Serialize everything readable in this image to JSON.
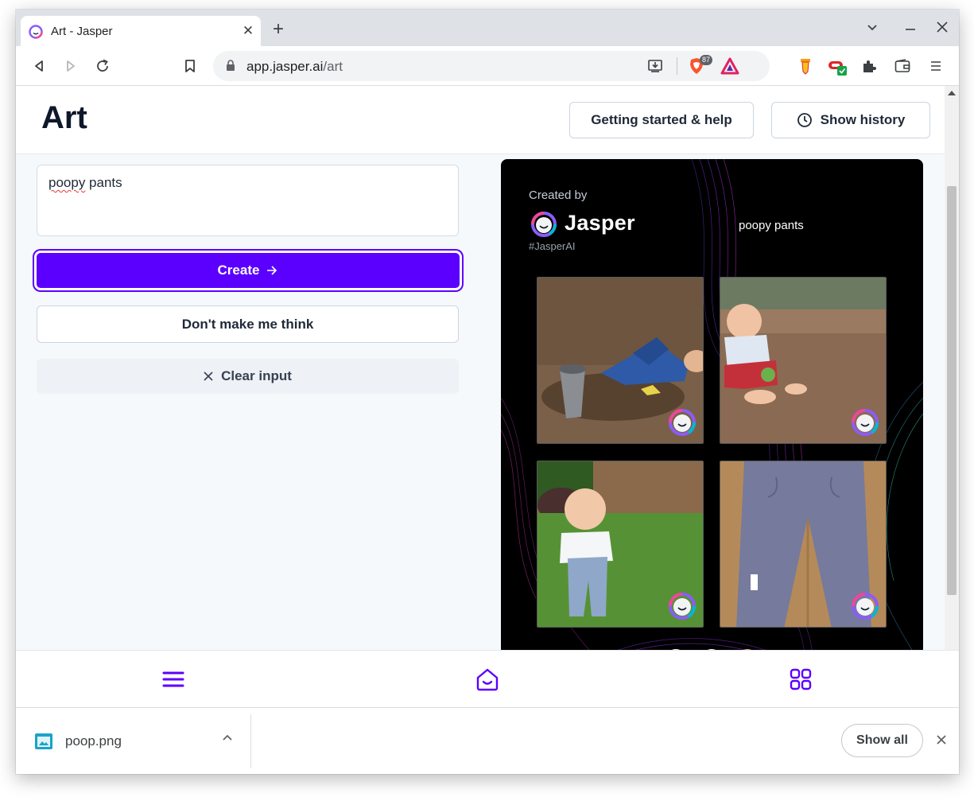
{
  "browser": {
    "tab_title": "Art - Jasper",
    "url_host": "app.jasper.ai",
    "url_path": "/art",
    "brave_badge": "87"
  },
  "header": {
    "title": "Art",
    "help_button": "Getting started & help",
    "history_button": "Show history"
  },
  "form": {
    "prompt_first_word": "poopy",
    "prompt_rest": " pants",
    "create_button": "Create",
    "dont_make_me_think_button": "Don't make me think",
    "clear_button": "Clear input"
  },
  "result_card": {
    "created_by": "Created by",
    "brand": "Jasper",
    "hashtag": "#JasperAI",
    "prompt": "poopy pants",
    "images": [
      "baby-lying-in-dirt",
      "baby-sitting-on-sand",
      "toddler-on-grass",
      "grey-pants-on-wood"
    ]
  },
  "download": {
    "file_name": "poop.png",
    "show_all": "Show all"
  },
  "colors": {
    "accent": "#5b00ff",
    "card_bg": "#000000",
    "page_bg": "#f6f9fc"
  }
}
